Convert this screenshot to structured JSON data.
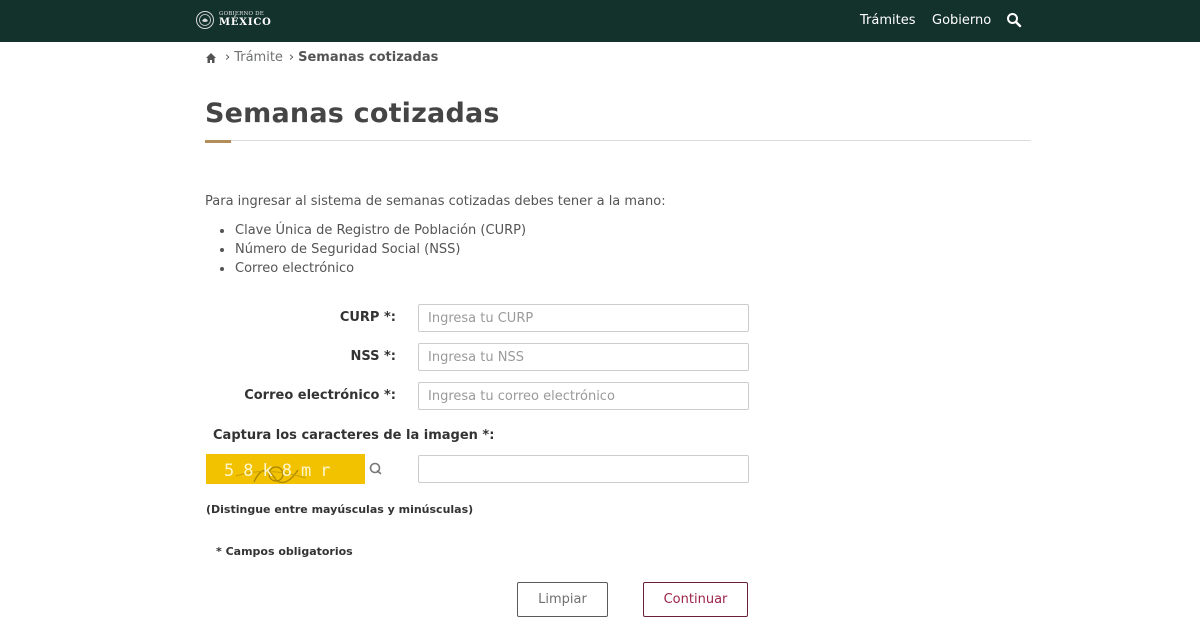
{
  "header": {
    "logo_line1": "GOBIERNO DE",
    "logo_line2": "MÉXICO",
    "nav": [
      {
        "label": "Trámites"
      },
      {
        "label": "Gobierno"
      }
    ],
    "search_icon": "search-icon",
    "background": "#13322b"
  },
  "breadcrumb": {
    "home_icon": "home-icon",
    "items": [
      {
        "label": "Trámite"
      },
      {
        "label": "Semanas cotizadas"
      }
    ]
  },
  "page": {
    "title": "Semanas cotizadas",
    "accent_color": "#b38e5d",
    "intro": "Para ingresar al sistema de semanas cotizadas debes tener a la mano:",
    "requirements": [
      "Clave Única de Registro de Población (CURP)",
      "Número de Seguridad Social (NSS)",
      "Correo electrónico"
    ]
  },
  "form": {
    "curp": {
      "label": "CURP *:",
      "placeholder": "Ingresa tu CURP",
      "value": ""
    },
    "nss": {
      "label": "NSS *:",
      "placeholder": "Ingresa tu NSS",
      "value": ""
    },
    "email": {
      "label": "Correo electrónico *:",
      "placeholder": "Ingresa tu correo electrónico",
      "value": ""
    },
    "captcha": {
      "label": "Captura los caracteres de la imagen *:",
      "image_text": "58k8mr",
      "image_color": "#f2c200",
      "refresh_icon": "refresh-icon",
      "value": ""
    },
    "case_note": "(Distingue entre mayúsculas y minúsculas)",
    "required_note": "* Campos obligatorios",
    "buttons": {
      "clear": "Limpiar",
      "continue": "Continuar",
      "continue_color": "#9d2449"
    }
  }
}
